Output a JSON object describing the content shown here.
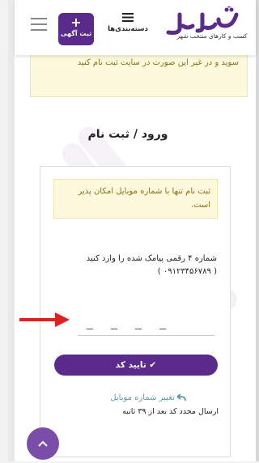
{
  "header": {
    "logo_tagline": "کسب و کارهای منتخب شهر",
    "categories_label": "دسته‌بندی‌ها",
    "post_ad_label": "ثبت آگهی",
    "post_ad_plus": "+"
  },
  "notice_top": {
    "text": "سوید و در غیر این صورت در سایت ثبت نام کنید"
  },
  "page_title": "ورود / ثبت نام",
  "form": {
    "notice": "ثبت نام تنها با شماره موبایل امکان پذیر است.",
    "instruction": "شماره ۴ رقمی پیامک شده را وارد کنید",
    "phone": "( ۰۹۱۲۳۴۵۶۷۸۹ )",
    "otp_placeholders": [
      "_",
      "_",
      "_",
      "_"
    ],
    "confirm_button": "✔ تایید کد",
    "change_number_link": "تغییر شماره موبایل",
    "resend_text": "ارسال مجدد کد بعد از ۳۹ ثانیه"
  },
  "icons": {
    "menu": "hamburger-icon",
    "categories": "list-icon",
    "arrow": "red-arrow-icon",
    "scroll_top": "chevron-up-icon",
    "back": "reply-arrow-icon"
  },
  "colors": {
    "brand_purple": "#5b2b8c",
    "notice_bg": "#fdf9dc",
    "notice_text": "#8a6d1a",
    "link": "#5b9aa6",
    "arrow_red": "#e02020"
  }
}
